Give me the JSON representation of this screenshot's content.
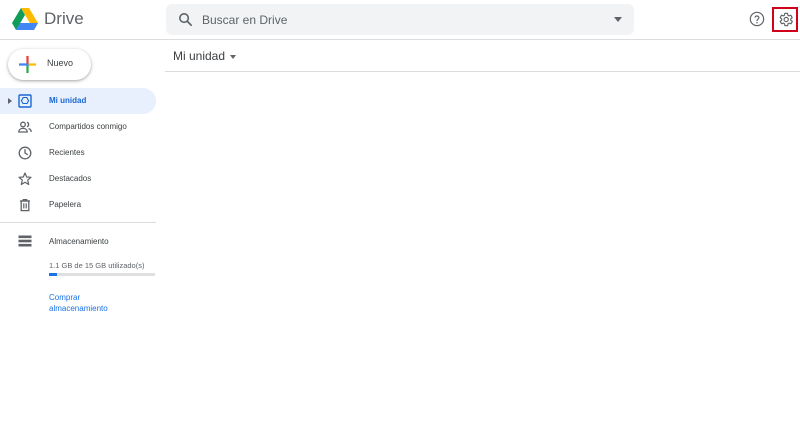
{
  "app": {
    "title": "Drive",
    "logo_icon": "google-drive-logo"
  },
  "search": {
    "placeholder": "Buscar en Drive",
    "icon": "search-icon",
    "options_icon": "caret-down-icon"
  },
  "header_actions": {
    "help_icon": "help-icon",
    "settings_icon": "gear-icon",
    "settings_highlight_color": "#d0021b"
  },
  "new_button": {
    "label": "Nuevo",
    "icon": "plus-icon"
  },
  "sidebar": {
    "items": [
      {
        "label": "Mi unidad",
        "icon": "drive-icon",
        "active": true
      },
      {
        "label": "Compartidos conmigo",
        "icon": "people-icon",
        "active": false
      },
      {
        "label": "Recientes",
        "icon": "clock-icon",
        "active": false
      },
      {
        "label": "Destacados",
        "icon": "star-icon",
        "active": false
      },
      {
        "label": "Papelera",
        "icon": "trash-icon",
        "active": false
      }
    ],
    "storage": {
      "label": "Almacenamiento",
      "icon": "storage-icon",
      "usage_text": "1.1 GB de 15 GB utilizado(s)",
      "used_fraction": 0.073,
      "buy_link": "Comprar almacenamiento"
    }
  },
  "main": {
    "title": "Mi unidad"
  },
  "colors": {
    "accent": "#1a73e8",
    "active_bg": "#e8f0fe",
    "active_text": "#1967d2"
  }
}
